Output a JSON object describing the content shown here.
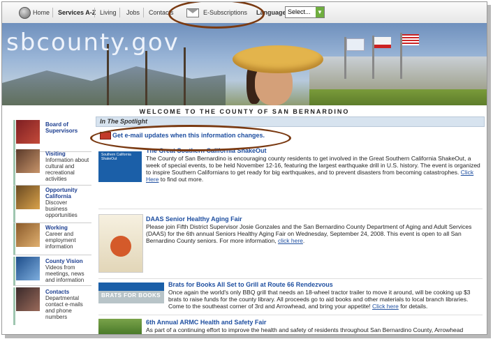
{
  "nav": {
    "items": [
      "Home",
      "Services A-Z",
      "Living",
      "Jobs",
      "Contacts"
    ],
    "subscriptions": "E-Subscriptions",
    "language_label": "Language:",
    "language_selected": "Select..."
  },
  "banner": {
    "logo": "sbcounty.gov"
  },
  "welcome": "WELCOME TO THE COUNTY OF SAN BERNARDINO",
  "sidebar": [
    {
      "title": "Board of Supervisors",
      "text": ""
    },
    {
      "title": "Visiting",
      "text": "Information about cultural and recreational activities"
    },
    {
      "title": "Opportunity California",
      "text": "Discover business opportunities"
    },
    {
      "title": "Working",
      "text": "Career and employment information"
    },
    {
      "title": "County Vision",
      "text": "Videos from meetings, news and information"
    },
    {
      "title": "Contacts",
      "text": "Departmental contact e-mails and phone numbers"
    }
  ],
  "spotlight": {
    "heading": "In The Spotlight",
    "subscribe_link": "Get e-mail updates when this information changes."
  },
  "stories": [
    {
      "title": "The Great Southern California ShakeOut",
      "thumb_text": "Southern California ShakeOut",
      "body": "The County of San Bernardino is encouraging county residents to get involved in the Great Southern California ShakeOut, a week of special events, to be held November 12-16, featuring the largest earthquake drill in U.S. history. The event is organized to inspire Southern Californians to get ready for big earthquakes, and to prevent disasters from becoming catastrophes.",
      "link": "Click Here",
      "after_link": " to find out more."
    },
    {
      "title": "DAAS Senior Healthy Aging Fair",
      "body": "Please join Fifth District Supervisor Josie Gonzales and the San Bernardino County Department of Aging and Adult Services (DAAS) for the 6th annual Seniors Healthy Aging Fair on Wednesday, September 24, 2008. This event is open to all San Bernardino County seniors. For more information,",
      "link": "click here",
      "after_link": "."
    },
    {
      "title": "Brats for Books All Set to Grill at Route 66 Rendezvous",
      "thumb_text": "BRATS FOR BOOKS",
      "body": "Once again the world's only BBQ grill that needs an 18-wheel tractor trailer to move it around, will be cooking up $3 brats to raise funds for the county library. All proceeds go to aid books and other materials to local branch libraries. Come to the southeast corner of 3rd and Arrowhead, and bring your appetite!",
      "link": "Click here",
      "after_link": " for details."
    },
    {
      "title": "6th Annual ARMC Health and Safety Fair",
      "body": "As part of a continuing effort to improve the health and safety of residents throughout San Bernardino County, Arrowhead",
      "link": "",
      "after_link": ""
    }
  ]
}
